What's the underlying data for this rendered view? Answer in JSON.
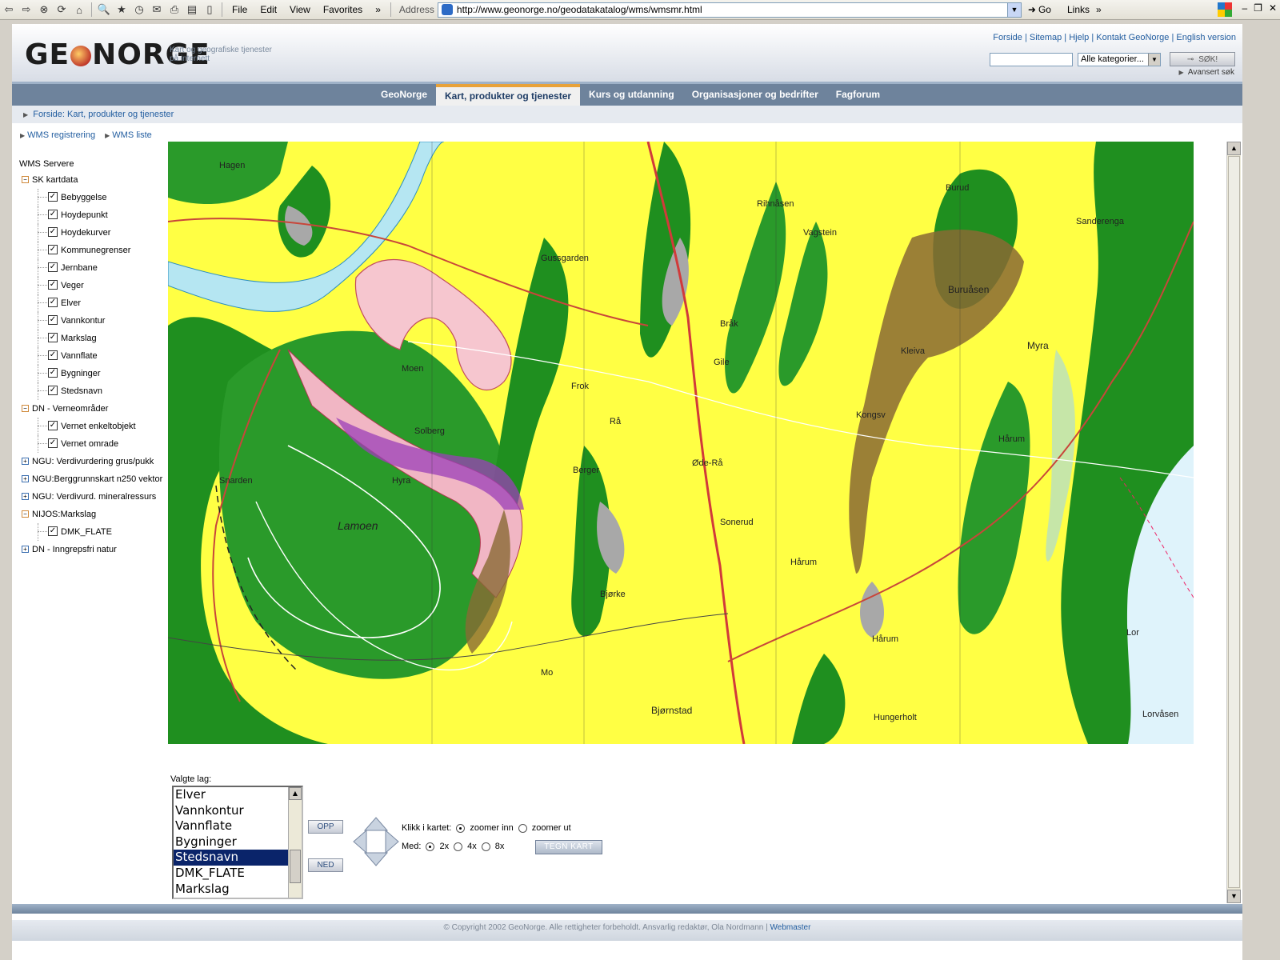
{
  "browser": {
    "menu": [
      "File",
      "Edit",
      "View",
      "Favorites"
    ],
    "address_label": "Address",
    "url": "http://www.geonorge.no/geodatakatalog/wms/wmsmr.html",
    "go_label": "Go",
    "links_label": "Links"
  },
  "site": {
    "logo": "GEONORGE",
    "tagline": "Kart og geografiske tjenester på internett",
    "top_links": [
      "Forside",
      "Sitemap",
      "Hjelp",
      "Kontakt GeoNorge",
      "English version"
    ],
    "search_category": "Alle kategorier...",
    "search_button": "SØK!",
    "advanced_search": "Avansert søk",
    "nav": [
      {
        "label": "GeoNorge",
        "active": false
      },
      {
        "label": "Kart, produkter og tjenester",
        "active": true
      },
      {
        "label": "Kurs og utdanning",
        "active": false
      },
      {
        "label": "Organisasjoner og bedrifter",
        "active": false
      },
      {
        "label": "Fagforum",
        "active": false
      }
    ],
    "breadcrumb": "Forside: Kart, produkter og tjenester",
    "subnav": [
      "WMS registrering",
      "WMS liste"
    ]
  },
  "tree": {
    "root": "WMS Servere",
    "groups": [
      {
        "label": "SK kartdata",
        "state": "-",
        "items": [
          "Bebyggelse",
          "Hoydepunkt",
          "Hoydekurver",
          "Kommunegrenser",
          "Jernbane",
          "Veger",
          "Elver",
          "Vannkontur",
          "Markslag",
          "Vannflate",
          "Bygninger",
          "Stedsnavn"
        ]
      },
      {
        "label": "DN - Verneområder",
        "state": "-",
        "items": [
          "Vernet enkeltobjekt",
          "Vernet omrade"
        ]
      },
      {
        "label": "NGU: Verdivurdering grus/pukk",
        "state": "+",
        "items": []
      },
      {
        "label": "NGU:Berggrunnskart n250 vektor",
        "state": "+",
        "items": []
      },
      {
        "label": "NGU: Verdivurd. mineralressurs",
        "state": "+",
        "items": []
      },
      {
        "label": "NIJOS:Markslag",
        "state": "-",
        "items": [
          "DMK_FLATE"
        ]
      },
      {
        "label": "DN - Inngrepsfri natur",
        "state": "+",
        "items": []
      }
    ]
  },
  "map": {
    "places": [
      "Hagen",
      "Rihnåsen",
      "Vagstein",
      "Burud",
      "Sanderenga",
      "Gussgarden",
      "Buruåsen",
      "Bråk",
      "Myra",
      "Kleiva",
      "Moen",
      "Gile",
      "Frok",
      "Rå",
      "Kongsv",
      "Hårum",
      "Solberg",
      "Berger",
      "Øde-Rå",
      "Snarden",
      "Hyra",
      "Lamoen",
      "Sonerud",
      "Hårum",
      "Bjørke",
      "Hårum",
      "Lor",
      "Mo",
      "Bjørnstad",
      "Hungerholt",
      "Lorvåsen"
    ]
  },
  "controls": {
    "selected_label": "Valgte lag:",
    "layers": [
      "Elver",
      "Vannkontur",
      "Vannflate",
      "Bygninger",
      "Stedsnavn",
      "DMK_FLATE",
      "Markslag"
    ],
    "selected_layer": "Stedsnavn",
    "up_button": "OPP",
    "down_button": "NED",
    "click_label": "Klikk i kartet:",
    "zoom_in": "zoomer inn",
    "zoom_out": "zoomer ut",
    "med_label": "Med:",
    "factors": [
      "2x",
      "4x",
      "8x"
    ],
    "draw_button": "TEGN KART"
  },
  "footer": {
    "text": "© Copyright 2002 GeoNorge. Alle rettigheter forbeholdt. Ansvarlig redaktør, Ola Nordmann |",
    "webmaster": "Webmaster"
  }
}
